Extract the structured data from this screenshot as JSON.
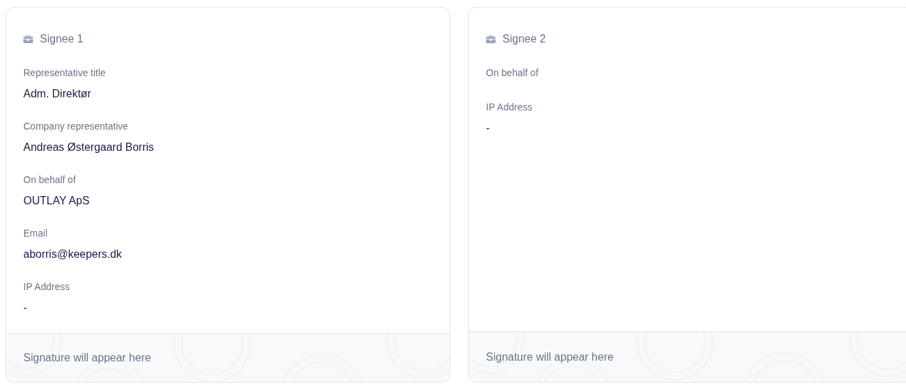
{
  "signees": [
    {
      "title": "Signee 1",
      "fields": [
        {
          "label": "Representative title",
          "value": "Adm. Direktør"
        },
        {
          "label": "Company representative",
          "value": "Andreas Østergaard Borris"
        },
        {
          "label": "On behalf of",
          "value": "OUTLAY ApS"
        },
        {
          "label": "Email",
          "value": "aborris@keepers.dk"
        },
        {
          "label": "IP Address",
          "value": "-"
        }
      ],
      "signature_placeholder": "Signature will appear here"
    },
    {
      "title": "Signee 2",
      "fields": [
        {
          "label": "On behalf of"
        },
        {
          "label": "IP Address",
          "value": "-"
        }
      ],
      "signature_placeholder": "Signature will appear here"
    }
  ]
}
